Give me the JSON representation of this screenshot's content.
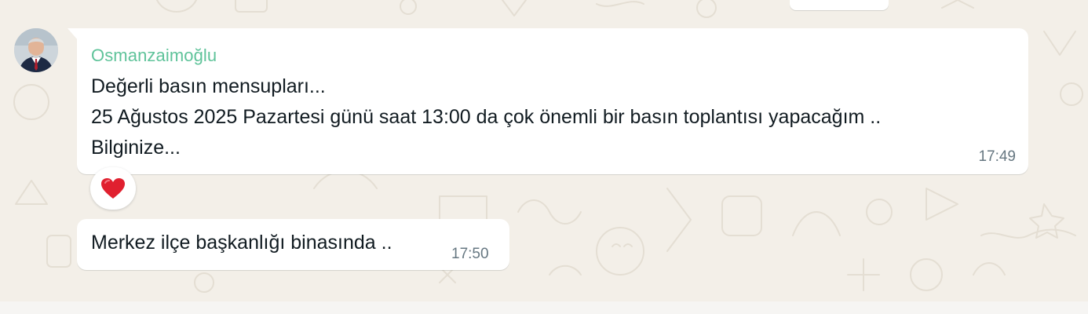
{
  "chat": {
    "messages": [
      {
        "sender": "Osmanzaimoğlu",
        "lines": [
          "Değerli basın mensupları...",
          "25 Ağustos 2025 Pazartesi günü saat 13:00 da çok önemli bir basın toplantısı yapacağım ..",
          "Bilginize..."
        ],
        "time": "17:49",
        "reaction": "❤️"
      },
      {
        "text": "Merkez ilçe başkanlığı binasında ..",
        "time": "17:50"
      }
    ]
  },
  "colors": {
    "chat_background": "#f3efe8",
    "bubble": "#ffffff",
    "sender_name": "#5fc39a",
    "message_text": "#111b21",
    "timestamp": "#667781",
    "reaction_heart": "#e0202f"
  },
  "icons": {
    "reaction": "red-heart-icon"
  }
}
